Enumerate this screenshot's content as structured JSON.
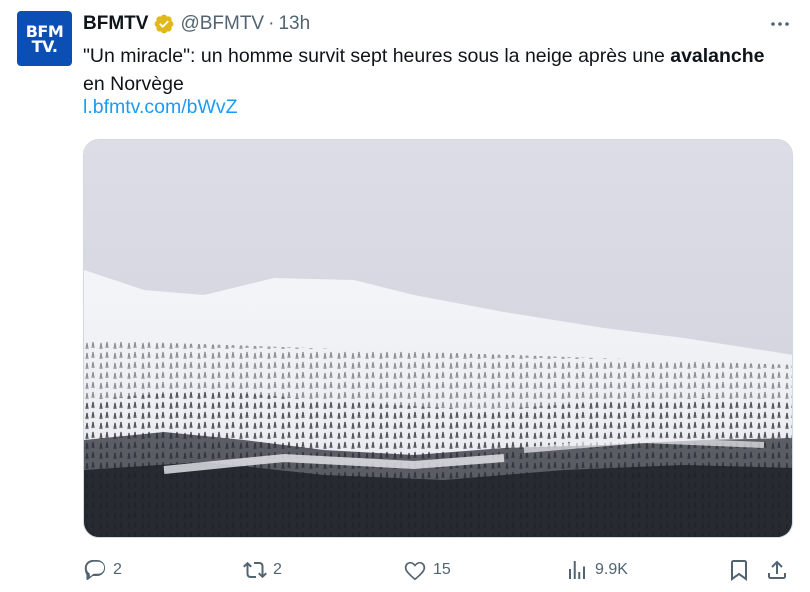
{
  "author": {
    "avatar_line1": "BFM",
    "avatar_line2": "TV.",
    "name": "BFMTV",
    "handle": "@BFMTV",
    "separator": "·",
    "time": "13h"
  },
  "tweet": {
    "text_part1": "\"Un miracle\": un homme survit sept heures sous la neige après une ",
    "text_bold": "avalanche",
    "text_part2": " en Norvège",
    "link": "l.bfmtv.com/bWvZ"
  },
  "actions": {
    "reply_count": "2",
    "retweet_count": "2",
    "like_count": "15",
    "views_count": "9.9K"
  },
  "colors": {
    "accent": "#1d9bf0",
    "muted": "#536471",
    "avatar_bg": "#0b4fb4"
  },
  "icons": [
    "verified-badge-icon",
    "more-icon",
    "reply-icon",
    "retweet-icon",
    "like-icon",
    "views-icon",
    "bookmark-icon",
    "share-icon"
  ]
}
